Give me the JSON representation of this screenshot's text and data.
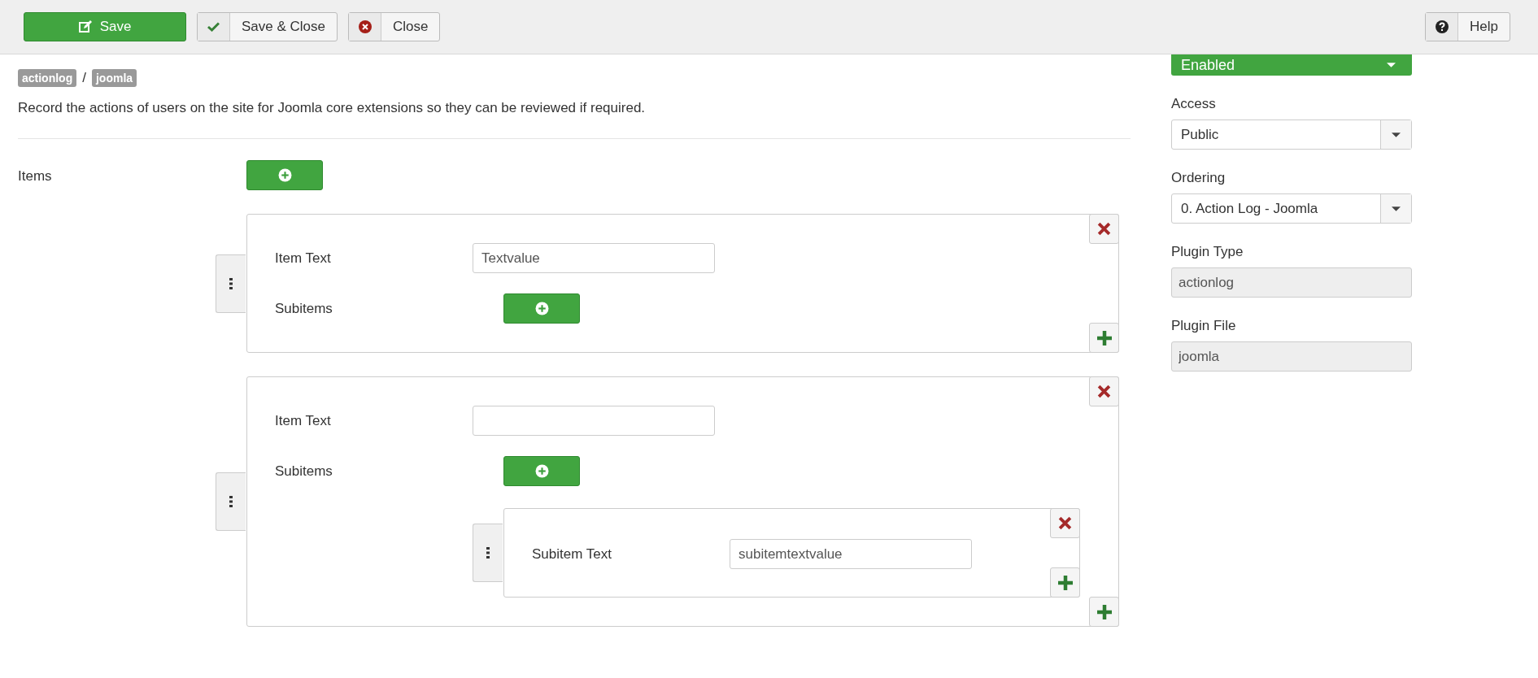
{
  "toolbar": {
    "buttons": [
      {
        "kind": "save",
        "label": "Save"
      },
      {
        "kind": "save-close",
        "label": "Save & Close"
      },
      {
        "kind": "close",
        "label": "Close"
      }
    ],
    "help": {
      "label": "Help"
    }
  },
  "breadcrumb": {
    "badges": [
      "actionlog",
      "joomla"
    ],
    "separator": "/"
  },
  "description": "Record the actions of users on the site for Joomla core extensions so they can be reviewed if required.",
  "items_field": {
    "label": "Items",
    "items": [
      {
        "item_text_label": "Item Text",
        "item_text": "Textvalue",
        "subitems_label": "Subitems"
      },
      {
        "item_text_label": "Item Text",
        "subitems_label": "Subitems",
        "subitems": [
          {
            "label": "Subitem Text",
            "value": "subitemtextvalue"
          }
        ]
      }
    ]
  },
  "sidebar": {
    "status": {
      "value": "Enabled"
    },
    "fields": [
      {
        "label": "Access",
        "value": "Public",
        "kind": "select"
      },
      {
        "label": "Ordering",
        "value": "0. Action Log - Joomla",
        "kind": "select"
      },
      {
        "label": "Plugin Type",
        "value": "actionlog",
        "kind": "readonly"
      },
      {
        "label": "Plugin File",
        "value": "joomla",
        "kind": "readonly"
      }
    ]
  }
}
